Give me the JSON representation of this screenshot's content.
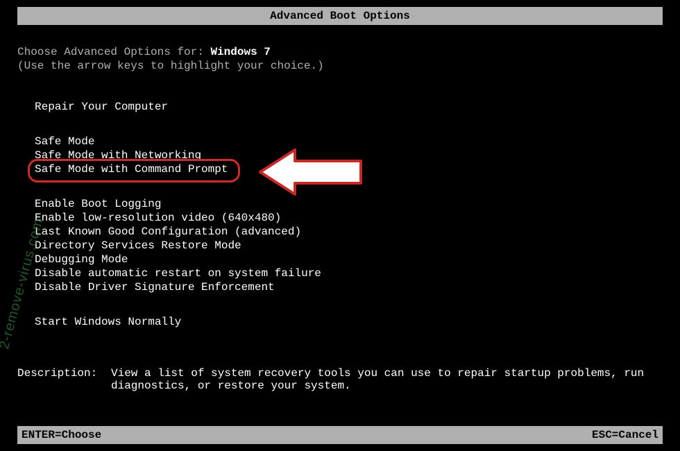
{
  "title": "Advanced Boot Options",
  "intro": {
    "prefix": "Choose Advanced Options for: ",
    "os": "Windows 7",
    "hint": "(Use the arrow keys to highlight your choice.)"
  },
  "groups": [
    [
      "Repair Your Computer"
    ],
    [
      "Safe Mode",
      "Safe Mode with Networking",
      "Safe Mode with Command Prompt"
    ],
    [
      "Enable Boot Logging",
      "Enable low-resolution video (640x480)",
      "Last Known Good Configuration (advanced)",
      "Directory Services Restore Mode",
      "Debugging Mode",
      "Disable automatic restart on system failure",
      "Disable Driver Signature Enforcement"
    ],
    [
      "Start Windows Normally"
    ]
  ],
  "highlighted": "Safe Mode with Command Prompt",
  "description": {
    "label": "Description:",
    "text": "View a list of system recovery tools you can use to repair startup problems, run diagnostics, or restore your system."
  },
  "footer": {
    "left": "ENTER=Choose",
    "right": "ESC=Cancel"
  },
  "watermark": "2-remove-virus.com"
}
